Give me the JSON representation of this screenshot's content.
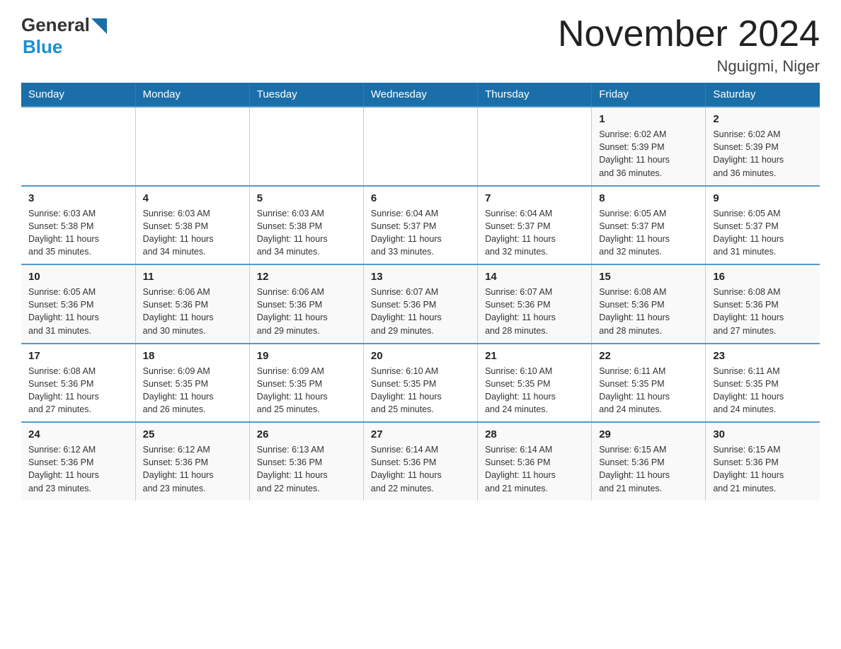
{
  "header": {
    "title": "November 2024",
    "subtitle": "Nguigmi, Niger",
    "logo_general": "General",
    "logo_blue": "Blue"
  },
  "weekdays": [
    "Sunday",
    "Monday",
    "Tuesday",
    "Wednesday",
    "Thursday",
    "Friday",
    "Saturday"
  ],
  "weeks": [
    {
      "days": [
        {
          "num": "",
          "info": ""
        },
        {
          "num": "",
          "info": ""
        },
        {
          "num": "",
          "info": ""
        },
        {
          "num": "",
          "info": ""
        },
        {
          "num": "",
          "info": ""
        },
        {
          "num": "1",
          "info": "Sunrise: 6:02 AM\nSunset: 5:39 PM\nDaylight: 11 hours\nand 36 minutes."
        },
        {
          "num": "2",
          "info": "Sunrise: 6:02 AM\nSunset: 5:39 PM\nDaylight: 11 hours\nand 36 minutes."
        }
      ]
    },
    {
      "days": [
        {
          "num": "3",
          "info": "Sunrise: 6:03 AM\nSunset: 5:38 PM\nDaylight: 11 hours\nand 35 minutes."
        },
        {
          "num": "4",
          "info": "Sunrise: 6:03 AM\nSunset: 5:38 PM\nDaylight: 11 hours\nand 34 minutes."
        },
        {
          "num": "5",
          "info": "Sunrise: 6:03 AM\nSunset: 5:38 PM\nDaylight: 11 hours\nand 34 minutes."
        },
        {
          "num": "6",
          "info": "Sunrise: 6:04 AM\nSunset: 5:37 PM\nDaylight: 11 hours\nand 33 minutes."
        },
        {
          "num": "7",
          "info": "Sunrise: 6:04 AM\nSunset: 5:37 PM\nDaylight: 11 hours\nand 32 minutes."
        },
        {
          "num": "8",
          "info": "Sunrise: 6:05 AM\nSunset: 5:37 PM\nDaylight: 11 hours\nand 32 minutes."
        },
        {
          "num": "9",
          "info": "Sunrise: 6:05 AM\nSunset: 5:37 PM\nDaylight: 11 hours\nand 31 minutes."
        }
      ]
    },
    {
      "days": [
        {
          "num": "10",
          "info": "Sunrise: 6:05 AM\nSunset: 5:36 PM\nDaylight: 11 hours\nand 31 minutes."
        },
        {
          "num": "11",
          "info": "Sunrise: 6:06 AM\nSunset: 5:36 PM\nDaylight: 11 hours\nand 30 minutes."
        },
        {
          "num": "12",
          "info": "Sunrise: 6:06 AM\nSunset: 5:36 PM\nDaylight: 11 hours\nand 29 minutes."
        },
        {
          "num": "13",
          "info": "Sunrise: 6:07 AM\nSunset: 5:36 PM\nDaylight: 11 hours\nand 29 minutes."
        },
        {
          "num": "14",
          "info": "Sunrise: 6:07 AM\nSunset: 5:36 PM\nDaylight: 11 hours\nand 28 minutes."
        },
        {
          "num": "15",
          "info": "Sunrise: 6:08 AM\nSunset: 5:36 PM\nDaylight: 11 hours\nand 28 minutes."
        },
        {
          "num": "16",
          "info": "Sunrise: 6:08 AM\nSunset: 5:36 PM\nDaylight: 11 hours\nand 27 minutes."
        }
      ]
    },
    {
      "days": [
        {
          "num": "17",
          "info": "Sunrise: 6:08 AM\nSunset: 5:36 PM\nDaylight: 11 hours\nand 27 minutes."
        },
        {
          "num": "18",
          "info": "Sunrise: 6:09 AM\nSunset: 5:35 PM\nDaylight: 11 hours\nand 26 minutes."
        },
        {
          "num": "19",
          "info": "Sunrise: 6:09 AM\nSunset: 5:35 PM\nDaylight: 11 hours\nand 25 minutes."
        },
        {
          "num": "20",
          "info": "Sunrise: 6:10 AM\nSunset: 5:35 PM\nDaylight: 11 hours\nand 25 minutes."
        },
        {
          "num": "21",
          "info": "Sunrise: 6:10 AM\nSunset: 5:35 PM\nDaylight: 11 hours\nand 24 minutes."
        },
        {
          "num": "22",
          "info": "Sunrise: 6:11 AM\nSunset: 5:35 PM\nDaylight: 11 hours\nand 24 minutes."
        },
        {
          "num": "23",
          "info": "Sunrise: 6:11 AM\nSunset: 5:35 PM\nDaylight: 11 hours\nand 24 minutes."
        }
      ]
    },
    {
      "days": [
        {
          "num": "24",
          "info": "Sunrise: 6:12 AM\nSunset: 5:36 PM\nDaylight: 11 hours\nand 23 minutes."
        },
        {
          "num": "25",
          "info": "Sunrise: 6:12 AM\nSunset: 5:36 PM\nDaylight: 11 hours\nand 23 minutes."
        },
        {
          "num": "26",
          "info": "Sunrise: 6:13 AM\nSunset: 5:36 PM\nDaylight: 11 hours\nand 22 minutes."
        },
        {
          "num": "27",
          "info": "Sunrise: 6:14 AM\nSunset: 5:36 PM\nDaylight: 11 hours\nand 22 minutes."
        },
        {
          "num": "28",
          "info": "Sunrise: 6:14 AM\nSunset: 5:36 PM\nDaylight: 11 hours\nand 21 minutes."
        },
        {
          "num": "29",
          "info": "Sunrise: 6:15 AM\nSunset: 5:36 PM\nDaylight: 11 hours\nand 21 minutes."
        },
        {
          "num": "30",
          "info": "Sunrise: 6:15 AM\nSunset: 5:36 PM\nDaylight: 11 hours\nand 21 minutes."
        }
      ]
    }
  ]
}
